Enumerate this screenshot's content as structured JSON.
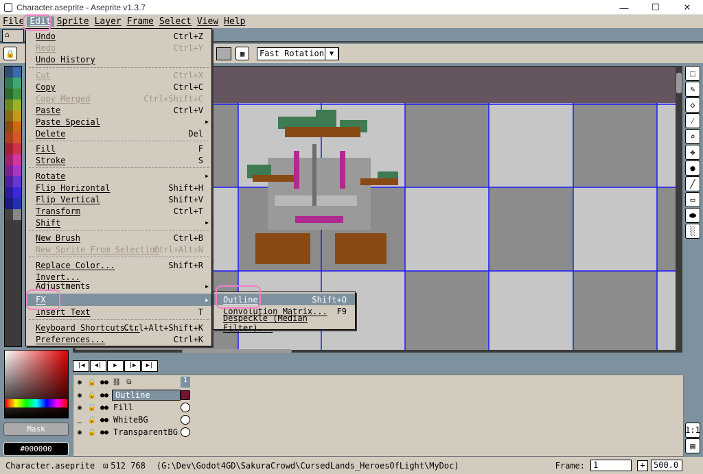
{
  "window": {
    "title": "Character.aseprite - Aseprite v1.3.7",
    "minimize": "—",
    "maximize": "☐",
    "close": "✕"
  },
  "menubar": [
    "File",
    "Edit",
    "Sprite",
    "Layer",
    "Frame",
    "Select",
    "View",
    "Help"
  ],
  "context_bar": {
    "rotation_algorithm": "Fast Rotation"
  },
  "edit_menu": {
    "items": [
      {
        "label": "Undo",
        "shortcut": "Ctrl+Z",
        "disabled": false
      },
      {
        "label": "Redo",
        "shortcut": "Ctrl+Y",
        "disabled": true
      },
      {
        "label": "Undo History",
        "shortcut": "",
        "disabled": false
      },
      {
        "label": "Cut",
        "shortcut": "Ctrl+X",
        "disabled": true
      },
      {
        "label": "Copy",
        "shortcut": "Ctrl+C",
        "disabled": false
      },
      {
        "label": "Copy Merged",
        "shortcut": "Ctrl+Shift+C",
        "disabled": true
      },
      {
        "label": "Paste",
        "shortcut": "Ctrl+V",
        "disabled": false
      },
      {
        "label": "Paste Special",
        "shortcut": "",
        "disabled": false,
        "submenu": true
      },
      {
        "label": "Delete",
        "shortcut": "Del",
        "disabled": false
      },
      {
        "label": "Fill",
        "shortcut": "F",
        "disabled": false
      },
      {
        "label": "Stroke",
        "shortcut": "S",
        "disabled": false
      },
      {
        "label": "Rotate",
        "shortcut": "",
        "disabled": false,
        "submenu": true
      },
      {
        "label": "Flip Horizontal",
        "shortcut": "Shift+H",
        "disabled": false
      },
      {
        "label": "Flip Vertical",
        "shortcut": "Shift+V",
        "disabled": false
      },
      {
        "label": "Transform",
        "shortcut": "Ctrl+T",
        "disabled": false
      },
      {
        "label": "Shift",
        "shortcut": "",
        "disabled": false,
        "submenu": true
      },
      {
        "label": "New Brush",
        "shortcut": "Ctrl+B",
        "disabled": false
      },
      {
        "label": "New Sprite From Selection",
        "shortcut": "Ctrl+Alt+N",
        "disabled": true
      },
      {
        "label": "Replace Color...",
        "shortcut": "Shift+R",
        "disabled": false
      },
      {
        "label": "Invert...",
        "shortcut": "",
        "disabled": false
      },
      {
        "label": "Adjustments",
        "shortcut": "",
        "disabled": false,
        "submenu": true
      },
      {
        "label": "FX",
        "shortcut": "",
        "disabled": false,
        "submenu": true,
        "highlighted": true
      },
      {
        "label": "Insert Text",
        "shortcut": "T",
        "disabled": false
      },
      {
        "label": "Keyboard Shortcuts...",
        "shortcut": "Ctrl+Alt+Shift+K",
        "disabled": false
      },
      {
        "label": "Preferences...",
        "shortcut": "Ctrl+K",
        "disabled": false
      }
    ]
  },
  "fx_submenu": {
    "items": [
      {
        "label": "Outline",
        "shortcut": "Shift+O",
        "highlighted": true
      },
      {
        "label": "Convolution Matrix...",
        "shortcut": "F9"
      },
      {
        "label": "Despeckle (Median Filter)...",
        "shortcut": ""
      }
    ]
  },
  "color_bar": {
    "mask_label": "Mask",
    "color_hex": "#000000"
  },
  "timeline": {
    "frame_header": "1",
    "layers": [
      {
        "name": "Outline",
        "selected": true
      },
      {
        "name": "Fill",
        "selected": false
      },
      {
        "name": "WhiteBG",
        "selected": false
      },
      {
        "name": "TransparentBG",
        "selected": false
      }
    ]
  },
  "status": {
    "filename": "Character.aseprite",
    "size": "512 768",
    "path": "(G:\\Dev\\Godot4GD\\SakuraCrowd\\CursedLands_HeroesOfLight\\MyDoc)",
    "frame_label": "Frame:",
    "frame_value": "1",
    "zoom_value": "500.0"
  },
  "colors": {
    "accent_highlight": "#7d929e",
    "annotation_ring": "#f080c8",
    "ui_bg": "#d3cbbe"
  }
}
